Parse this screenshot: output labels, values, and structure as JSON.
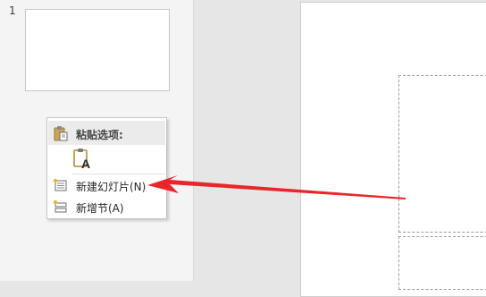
{
  "thumbnail_pane": {
    "slide_number": "1"
  },
  "context_menu": {
    "header_label": "粘贴选项:",
    "paste_option_icon": "paste-keep-text-icon",
    "items": [
      {
        "label": "新建幻灯片(N)",
        "icon": "new-slide-icon"
      },
      {
        "label": "新增节(A)",
        "icon": "new-section-icon"
      }
    ]
  },
  "annotation": {
    "arrow_color": "#e8262b"
  },
  "colors": {
    "pane_background": "#f4f4f4",
    "workspace_background": "#e6e6e6",
    "menu_header_background": "#ebebeb"
  }
}
